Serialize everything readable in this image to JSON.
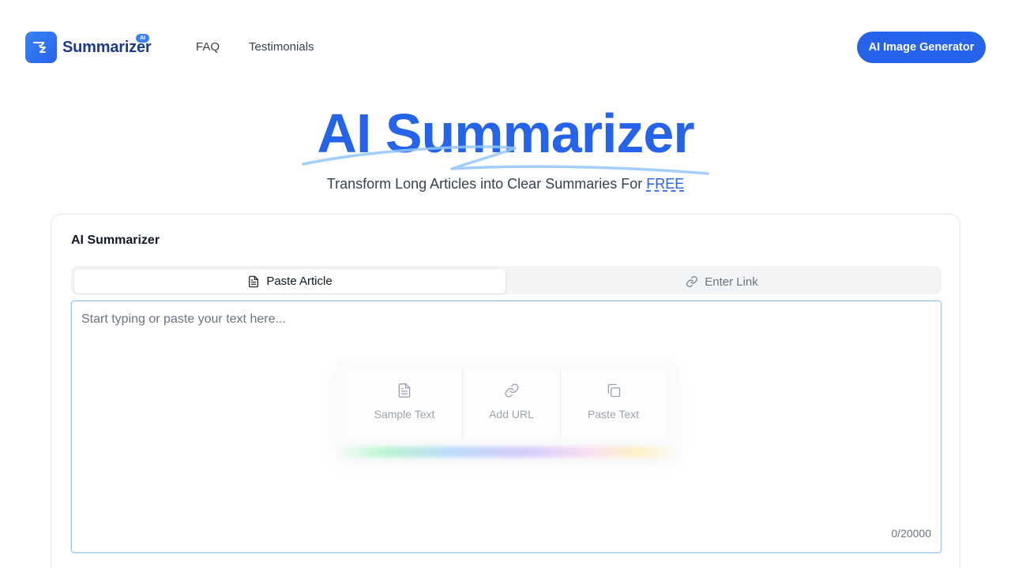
{
  "brand": {
    "name": "Summarizer",
    "badge": "AI",
    "color": "#2563eb"
  },
  "nav": {
    "links": [
      "FAQ",
      "Testimonials"
    ],
    "cta_label": "AI Image Generator"
  },
  "hero": {
    "title": "AI Summarizer",
    "subtitle_prefix": "Transform Long Articles into Clear Summaries For ",
    "subtitle_highlight": "FREE"
  },
  "card": {
    "title": "AI Summarizer",
    "tabs": [
      {
        "label": "Paste Article",
        "icon": "document-icon",
        "active": true
      },
      {
        "label": "Enter Link",
        "icon": "link-icon",
        "active": false
      }
    ],
    "editor": {
      "value": "",
      "placeholder": "Start typing or paste your text here...",
      "counter": "0/20000"
    },
    "quick_actions": [
      {
        "label": "Sample Text",
        "icon": "document-icon"
      },
      {
        "label": "Add URL",
        "icon": "link-icon"
      },
      {
        "label": "Paste Text",
        "icon": "copy-icon"
      }
    ]
  }
}
